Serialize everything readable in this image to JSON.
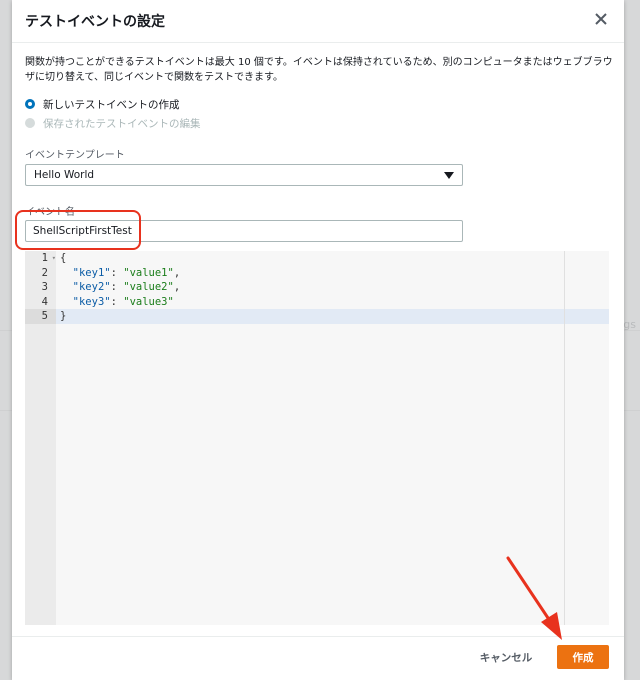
{
  "background": {
    "hint_text": "ogs"
  },
  "modal": {
    "title": "テストイベントの設定",
    "description": "関数が持つことができるテストイベントは最大 10 個です。イベントは保持されているため、別のコンピュータまたはウェブブラウザに切り替えて、同じイベントで関数をテストできます。",
    "options": [
      {
        "label": "新しいテストイベントの作成",
        "selected": true,
        "disabled": false
      },
      {
        "label": "保存されたテストイベントの編集",
        "selected": false,
        "disabled": true
      }
    ],
    "template_label": "イベントテンプレート",
    "template_value": "Hello World",
    "event_name_label": "イベント名",
    "event_name_value": "ShellScriptFirstTest",
    "editor": {
      "line_numbers": [
        "1",
        "2",
        "3",
        "4",
        "5"
      ],
      "lines": [
        {
          "open": "{"
        },
        {
          "key": "\"key1\"",
          "sep": ": ",
          "value": "\"value1\"",
          "end": ","
        },
        {
          "key": "\"key2\"",
          "sep": ": ",
          "value": "\"value2\"",
          "end": ","
        },
        {
          "key": "\"key3\"",
          "sep": ": ",
          "value": "\"value3\"",
          "end": ""
        },
        {
          "open": "}"
        }
      ]
    },
    "buttons": {
      "cancel": "キャンセル",
      "create": "作成"
    }
  },
  "colors": {
    "accent_orange": "#ec7211",
    "annotation_red": "#e8321e",
    "radio_blue": "#0073bb"
  }
}
